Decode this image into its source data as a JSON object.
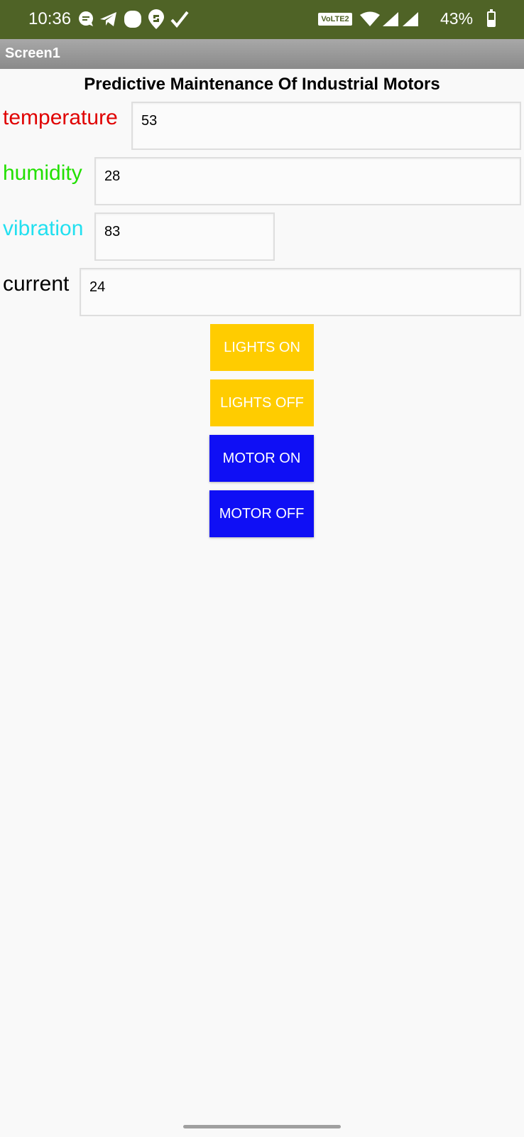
{
  "status_bar": {
    "time": "10:36",
    "network_badge": "VoLTE2",
    "battery_percent": "43%",
    "battery_level": 0.43,
    "icons_left": [
      "chat-bubble-icon",
      "telegram-icon",
      "app-blob-icon",
      "swiggy-icon",
      "check-icon"
    ],
    "icons_right": [
      "wifi-icon",
      "signal-icon",
      "signal-icon",
      "battery-icon"
    ]
  },
  "title_bar": {
    "title": "Screen1"
  },
  "app": {
    "heading": "Predictive Maintenance Of Industrial Motors",
    "fields": [
      {
        "label": "temperature",
        "value": "53",
        "label_color": "#e00000"
      },
      {
        "label": "humidity",
        "value": "28",
        "label_color": "#22e000"
      },
      {
        "label": "vibration",
        "value": "83",
        "label_color": "#22e0f0"
      },
      {
        "label": "current",
        "value": "24",
        "label_color": "#000000"
      }
    ],
    "buttons": [
      {
        "label": "LIGHTS ON",
        "color": "#ffcc00"
      },
      {
        "label": "LIGHTS OFF",
        "color": "#ffcc00"
      },
      {
        "label": "MOTOR ON",
        "color": "#0f0ff5"
      },
      {
        "label": "MOTOR OFF",
        "color": "#0f0ff5"
      }
    ]
  }
}
